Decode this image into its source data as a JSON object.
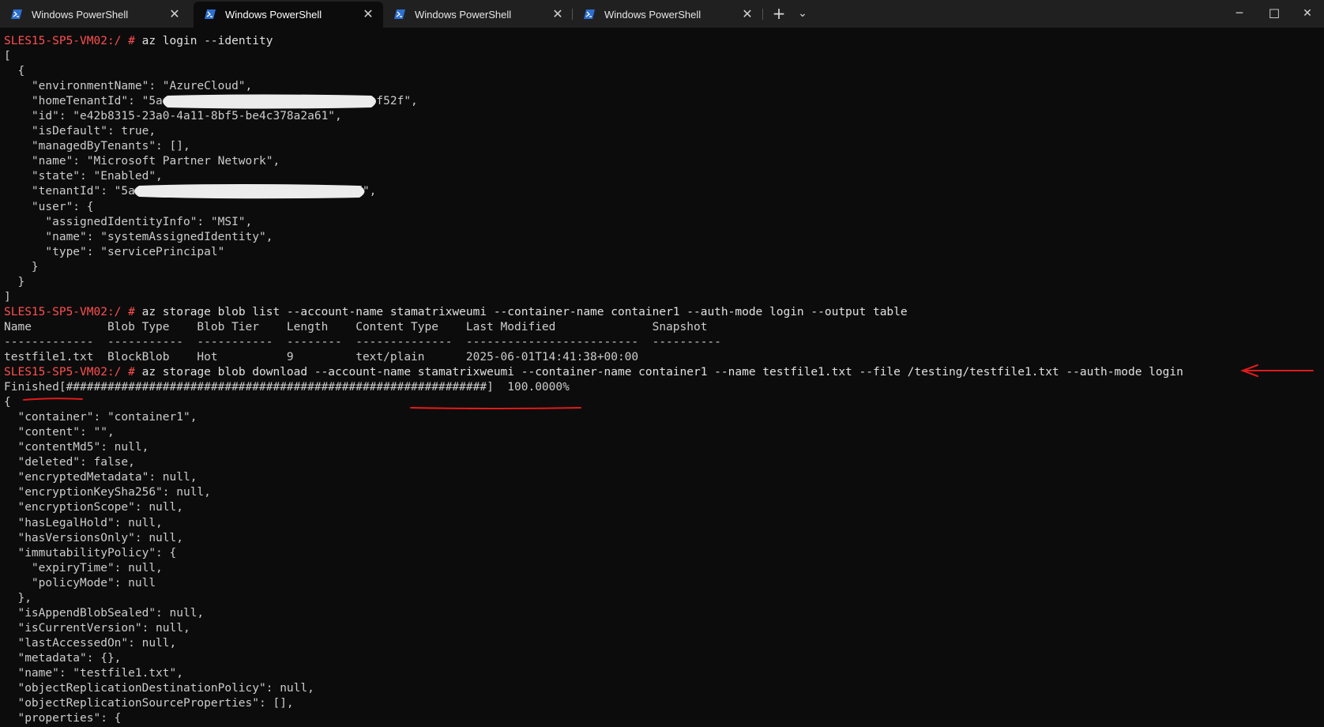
{
  "tabs": [
    {
      "title": "Windows PowerShell",
      "active": false
    },
    {
      "title": "Windows PowerShell",
      "active": true
    },
    {
      "title": "Windows PowerShell",
      "active": false
    },
    {
      "title": "Windows PowerShell",
      "active": false
    }
  ],
  "window_controls": {
    "new_tab": "+",
    "dropdown": "⌄",
    "minimize": "─",
    "maximize": "☐",
    "close": "✕"
  },
  "terminal": {
    "prompt": "SLES15-SP5-VM02:/ # ",
    "lines": [
      {
        "type": "cmd",
        "text": "az login --identity"
      },
      {
        "type": "out",
        "text": "["
      },
      {
        "type": "out",
        "text": "  {"
      },
      {
        "type": "out",
        "text": "    \"environmentName\": \"AzureCloud\","
      },
      {
        "type": "out",
        "text": "    \"homeTenantId\": \"5a                              bf52f\","
      },
      {
        "type": "out",
        "text": "    \"id\": \"e42b8315-23a0-4a11-8bf5-be4c378a2a61\","
      },
      {
        "type": "out",
        "text": "    \"isDefault\": true,"
      },
      {
        "type": "out",
        "text": "    \"managedByTenants\": [],"
      },
      {
        "type": "out",
        "text": "    \"name\": \"Microsoft Partner Network\","
      },
      {
        "type": "out",
        "text": "    \"state\": \"Enabled\","
      },
      {
        "type": "out",
        "text": "    \"tenantId\": \"5a                              52f\","
      },
      {
        "type": "out",
        "text": "    \"user\": {"
      },
      {
        "type": "out",
        "text": "      \"assignedIdentityInfo\": \"MSI\","
      },
      {
        "type": "out",
        "text": "      \"name\": \"systemAssignedIdentity\","
      },
      {
        "type": "out",
        "text": "      \"type\": \"servicePrincipal\""
      },
      {
        "type": "out",
        "text": "    }"
      },
      {
        "type": "out",
        "text": "  }"
      },
      {
        "type": "out",
        "text": "]"
      },
      {
        "type": "cmd",
        "text": "az storage blob list --account-name stamatrixweumi --container-name container1 --auth-mode login --output table"
      },
      {
        "type": "out",
        "text": "Name           Blob Type    Blob Tier    Length    Content Type    Last Modified              Snapshot"
      },
      {
        "type": "out",
        "text": "-------------  -----------  -----------  --------  --------------  -------------------------  ----------"
      },
      {
        "type": "out",
        "text": "testfile1.txt  BlockBlob    Hot          9         text/plain      2025-06-01T14:41:38+00:00"
      },
      {
        "type": "cmd",
        "text": "az storage blob download --account-name stamatrixweumi --container-name container1 --name testfile1.txt --file /testing/testfile1.txt --auth-mode login"
      },
      {
        "type": "out",
        "text": "Finished[#############################################################]  100.0000%"
      },
      {
        "type": "out",
        "text": "{"
      },
      {
        "type": "out",
        "text": "  \"container\": \"container1\","
      },
      {
        "type": "out",
        "text": "  \"content\": \"\","
      },
      {
        "type": "out",
        "text": "  \"contentMd5\": null,"
      },
      {
        "type": "out",
        "text": "  \"deleted\": false,"
      },
      {
        "type": "out",
        "text": "  \"encryptedMetadata\": null,"
      },
      {
        "type": "out",
        "text": "  \"encryptionKeySha256\": null,"
      },
      {
        "type": "out",
        "text": "  \"encryptionScope\": null,"
      },
      {
        "type": "out",
        "text": "  \"hasLegalHold\": null,"
      },
      {
        "type": "out",
        "text": "  \"hasVersionsOnly\": null,"
      },
      {
        "type": "out",
        "text": "  \"immutabilityPolicy\": {"
      },
      {
        "type": "out",
        "text": "    \"expiryTime\": null,"
      },
      {
        "type": "out",
        "text": "    \"policyMode\": null"
      },
      {
        "type": "out",
        "text": "  },"
      },
      {
        "type": "out",
        "text": "  \"isAppendBlobSealed\": null,"
      },
      {
        "type": "out",
        "text": "  \"isCurrentVersion\": null,"
      },
      {
        "type": "out",
        "text": "  \"lastAccessedOn\": null,"
      },
      {
        "type": "out",
        "text": "  \"metadata\": {},"
      },
      {
        "type": "out",
        "text": "  \"name\": \"testfile1.txt\","
      },
      {
        "type": "out",
        "text": "  \"objectReplicationDestinationPolicy\": null,"
      },
      {
        "type": "out",
        "text": "  \"objectReplicationSourceProperties\": [],"
      },
      {
        "type": "out",
        "text": "  \"properties\": {"
      }
    ]
  },
  "colors": {
    "background": "#0c0c0c",
    "titlebar": "#202020",
    "prompt": "#ff4f4f",
    "text": "#cccccc",
    "annotation": "#e01b1b",
    "redaction": "#ededed"
  },
  "icons": {
    "tab_icon": "powershell-icon"
  }
}
